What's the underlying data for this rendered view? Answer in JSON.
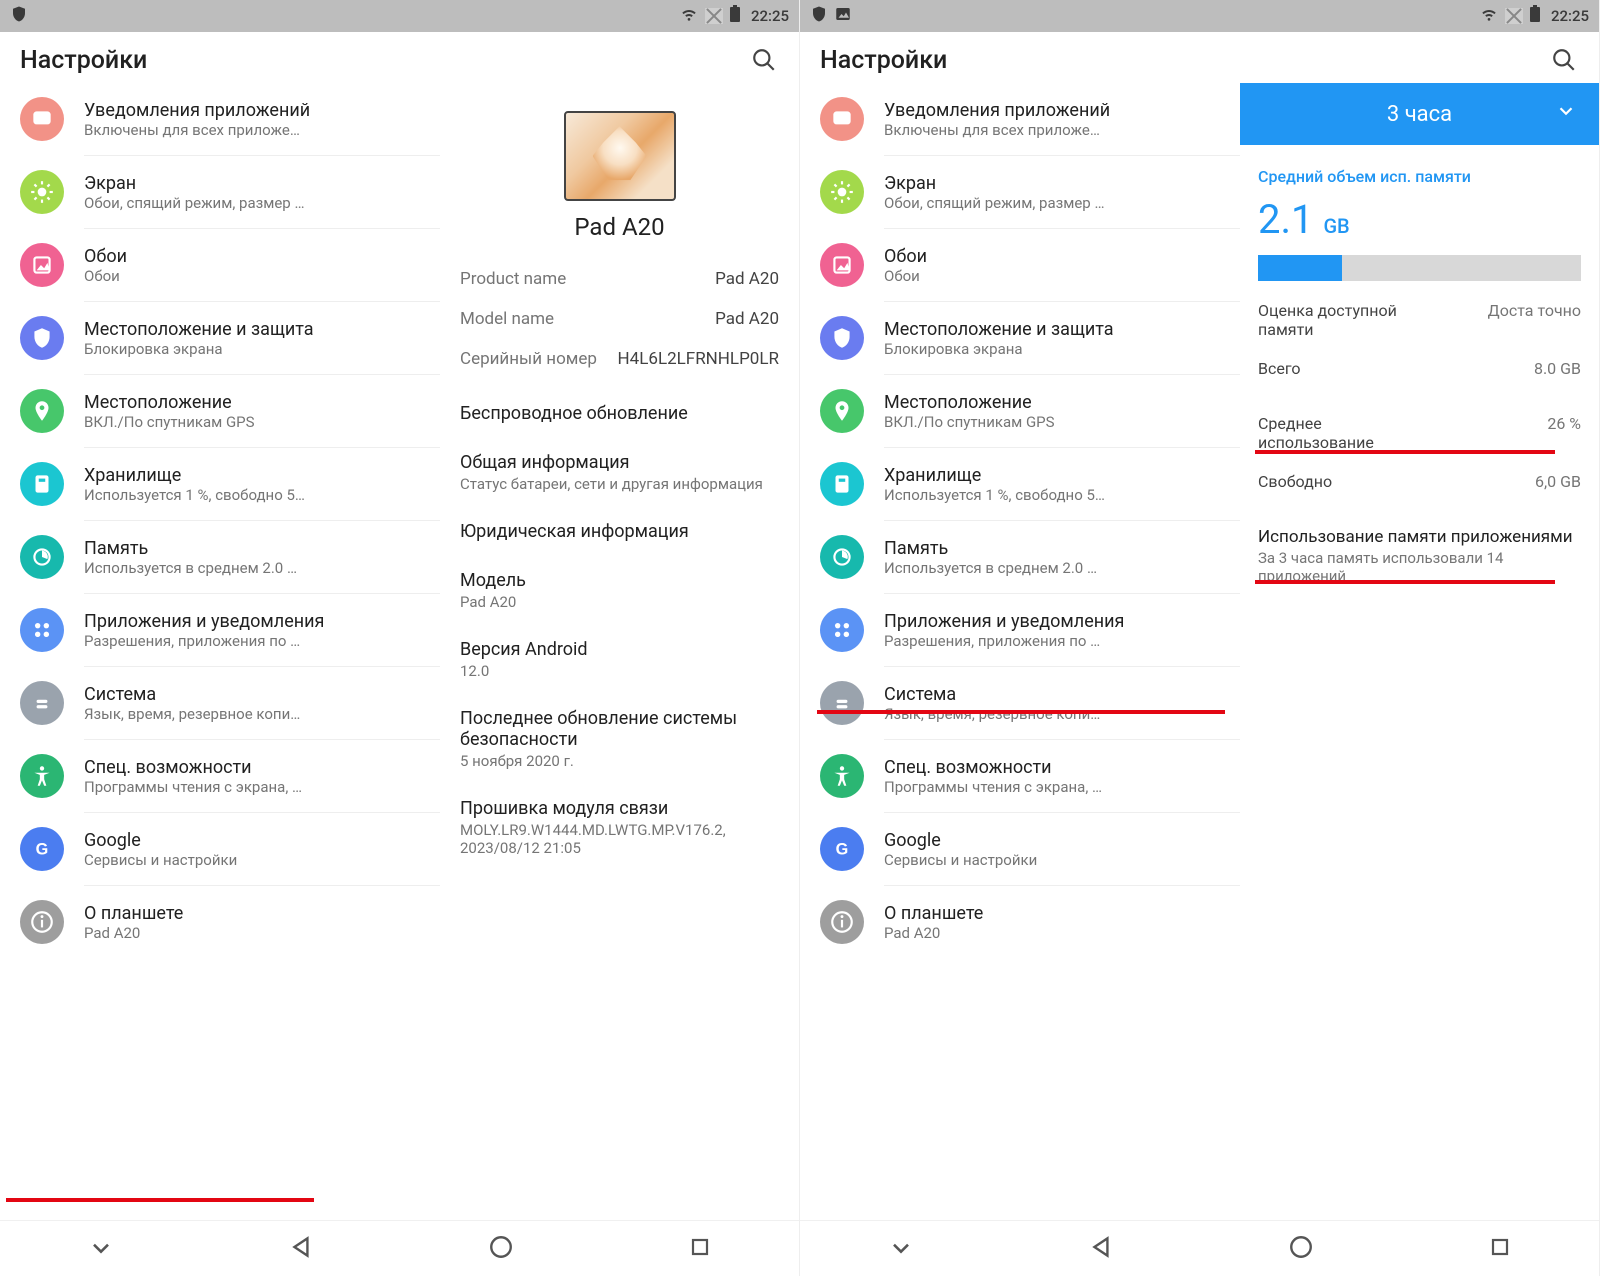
{
  "status": {
    "time": "22:25"
  },
  "header": {
    "title": "Настройки"
  },
  "settings": [
    {
      "title": "Уведомления приложений",
      "subtitle": "Включены для всех приложе…",
      "color": "#f29287",
      "icon": "message"
    },
    {
      "title": "Экран",
      "subtitle": "Обои, спящий режим, размер …",
      "color": "#a3d94b",
      "icon": "brightness"
    },
    {
      "title": "Обои",
      "subtitle": "Обои",
      "color": "#f06292",
      "icon": "wallpaper"
    },
    {
      "title": "Местоположение и защита",
      "subtitle": "Блокировка экрана",
      "color": "#6a7cf0",
      "icon": "shield"
    },
    {
      "title": "Местоположение",
      "subtitle": "ВКЛ./По спутникам GPS",
      "color": "#47c76b",
      "icon": "location"
    },
    {
      "title": "Хранилище",
      "subtitle": "Используется 1 %, свободно 5…",
      "color": "#1bc6d1",
      "icon": "storage"
    },
    {
      "title": "Память",
      "subtitle": "Используется в среднем 2.0 …",
      "color": "#17b9ad",
      "icon": "memory"
    },
    {
      "title": "Приложения и уведомления",
      "subtitle": "Разрешения, приложения по …",
      "color": "#5b93f5",
      "icon": "apps"
    },
    {
      "title": "Система",
      "subtitle": "Язык, время, резервное копи…",
      "color": "#9aa3ad",
      "icon": "system"
    },
    {
      "title": "Спец. возможности",
      "subtitle": "Программы чтения с экрана, …",
      "color": "#2bb673",
      "icon": "a11y"
    },
    {
      "title": "Google",
      "subtitle": "Сервисы и настройки",
      "color": "#4b7df0",
      "icon": "google"
    },
    {
      "title": "О планшете",
      "subtitle": "Pad A20",
      "color": "#9e9e9e",
      "icon": "info"
    }
  ],
  "device": {
    "name": "Pad A20",
    "kv": [
      {
        "k": "Product name",
        "v": "Pad A20"
      },
      {
        "k": "Model name",
        "v": "Pad A20"
      },
      {
        "k": "Серийный номер",
        "v": "H4L6L2LFRNHLP0LR"
      }
    ],
    "items": [
      {
        "title": "Беспроводное обновление",
        "sub": ""
      },
      {
        "title": "Общая информация",
        "sub": "Статус батареи, сети и другая информация"
      },
      {
        "title": "Юридическая информация",
        "sub": ""
      },
      {
        "title": "Модель",
        "sub": "Pad A20"
      },
      {
        "title": "Версия Android",
        "sub": "12.0"
      },
      {
        "title": "Последнее обновление системы безопасности",
        "sub": "5 ноября 2020 г."
      },
      {
        "title": "Прошивка модуля связи",
        "sub": "MOLY.LR9.W1444.MD.LWTG.MP.V176.2, 2023/08/12 21:05"
      }
    ]
  },
  "memory": {
    "period": "3 часа",
    "avg_label": "Средний объем исп. памяти",
    "avg_value": "2.1",
    "avg_unit": "GB",
    "rows1": [
      {
        "k": "Оценка доступной памяти",
        "v": "Доста точно"
      },
      {
        "k": "Всего",
        "v": "8.0 GB"
      }
    ],
    "rows2": [
      {
        "k": "Среднее использование",
        "v": "26 %"
      },
      {
        "k": "Свободно",
        "v": "6,0 GB"
      }
    ],
    "apps": {
      "title": "Использование памяти приложениями",
      "sub": "За 3 часа память использовали 14 приложений"
    },
    "bar_percent": 26
  },
  "chart_data": {
    "type": "bar",
    "title": "Средний объем исп. памяти",
    "categories": [
      "used"
    ],
    "values": [
      26
    ],
    "xlabel": "",
    "ylabel": "%",
    "ylim": [
      0,
      100
    ]
  }
}
